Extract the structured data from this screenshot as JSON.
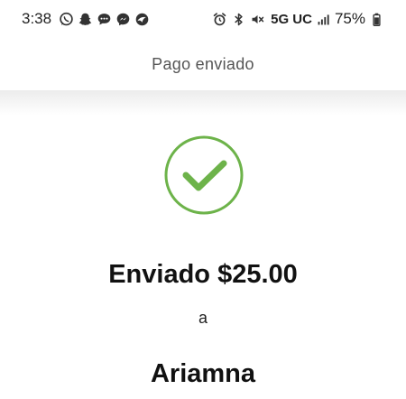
{
  "status_bar": {
    "time": "3:38",
    "network": "5G UC",
    "battery": "75%",
    "left_icons": [
      "whatsapp-icon",
      "snapchat-icon",
      "chat-bubble-icon",
      "messenger-icon",
      "browser-icon"
    ],
    "right_icons": [
      "alarm-icon",
      "bluetooth-icon",
      "mute-icon",
      "signal-icon",
      "battery-icon"
    ]
  },
  "header": {
    "title": "Pago enviado"
  },
  "confirmation": {
    "icon": "checkmark-circle-icon",
    "accent_color": "#6db34a",
    "sent_line": "Enviado $25.00",
    "to_word": "a",
    "recipient": "Ariamna"
  }
}
